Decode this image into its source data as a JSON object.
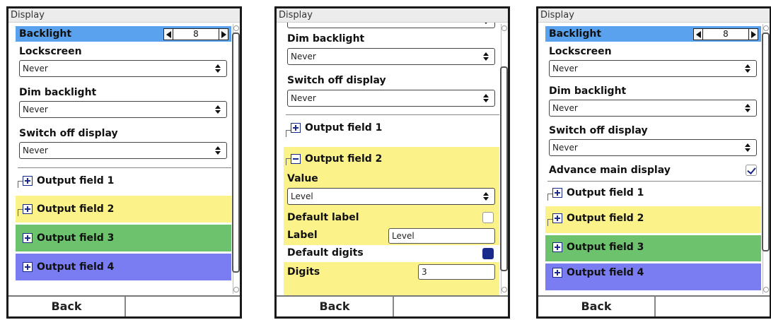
{
  "screens": [
    {
      "title": "Display",
      "backlight": {
        "label": "Backlight",
        "value": "8"
      },
      "lockscreen": {
        "label": "Lockscreen",
        "value": "Never"
      },
      "dim_backlight": {
        "label": "Dim backlight",
        "value": "Never"
      },
      "switch_off_display": {
        "label": "Switch off display",
        "value": "Never"
      },
      "output_fields": [
        "Output field 1",
        "Output field 2",
        "Output field 3",
        "Output field 4"
      ],
      "back_label": "Back"
    },
    {
      "title": "Display",
      "dim_backlight": {
        "label": "Dim backlight",
        "value": "Never"
      },
      "switch_off_display": {
        "label": "Switch off display",
        "value": "Never"
      },
      "output_field_1": "Output field 1",
      "output_field_2": {
        "title": "Output field 2",
        "value_label": "Value",
        "value": "Level",
        "default_label_label": "Default label",
        "label_label": "Label",
        "label_value": "Level",
        "default_digits_label": "Default digits",
        "digits_label": "Digits",
        "digits_value": "3"
      },
      "back_label": "Back"
    },
    {
      "title": "Display",
      "backlight": {
        "label": "Backlight",
        "value": "8"
      },
      "lockscreen": {
        "label": "Lockscreen",
        "value": "Never"
      },
      "dim_backlight": {
        "label": "Dim backlight",
        "value": "Never"
      },
      "switch_off_display": {
        "label": "Switch off display",
        "value": "Never"
      },
      "advance_main_display": {
        "label": "Advance main display",
        "checked": true
      },
      "output_fields": [
        "Output field 1",
        "Output field 2",
        "Output field 3",
        "Output field 4"
      ],
      "back_label": "Back"
    }
  ],
  "colors": {
    "selected_row": "#5aa2ee",
    "output_field_2": "#fbf28a",
    "output_field_3": "#6dc26d",
    "output_field_4": "#7a7df2"
  }
}
